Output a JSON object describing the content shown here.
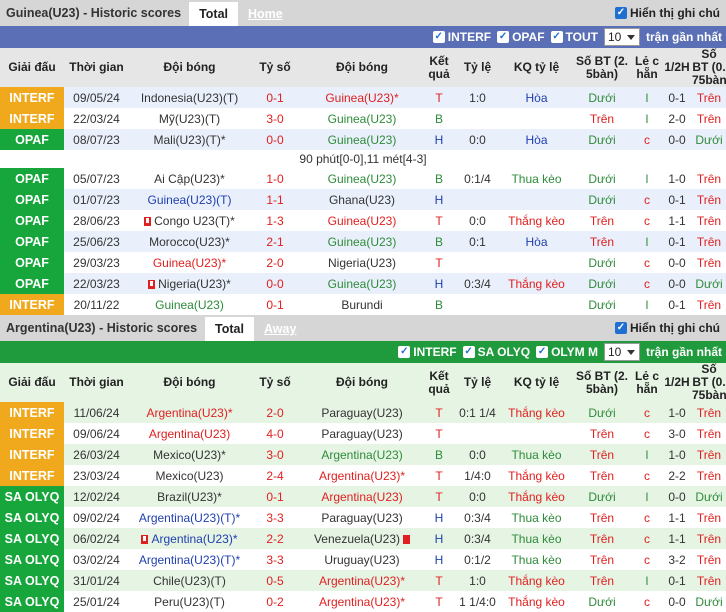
{
  "s1": {
    "title": "Guinea(U23) - Historic scores",
    "tab_total": "Total",
    "tab_other": "Home",
    "toggle": "Hiển thị ghi chú",
    "filters": [
      "INTERF",
      "OPAF",
      "TOUT"
    ],
    "count": "10",
    "count_label": "trận gần nhất",
    "cols": [
      "Giải đấu",
      "Thời gian",
      "Đội bóng",
      "Tỷ số",
      "Đội bóng",
      "Kết quả",
      "Tỷ lệ",
      "KQ tỷ lệ",
      "Số BT (2. 5bàn)",
      "Lẻ c hẵn",
      "1/2H",
      "Số BT (0. 75bàn)"
    ],
    "note": "90 phút[0-0],11 mét[4-3]",
    "rows": [
      {
        "lg": "INTERF",
        "t": "09/05/24",
        "h": "Indonesia(U23)(T)",
        "hc": "d",
        "s": "0-1",
        "a": "Guinea(U23)*",
        "ac": "r",
        "res": "T",
        "o": "1:0",
        "kq": "Hòa",
        "kqc": "b",
        "bt": "Dưới",
        "lc": "l",
        "ht": "0-1",
        "bt2": "Trên"
      },
      {
        "lg": "INTERF",
        "t": "22/03/24",
        "h": "Mỹ(U23)(T)",
        "hc": "d",
        "s": "3-0",
        "a": "Guinea(U23)",
        "ac": "g",
        "res": "B",
        "o": "",
        "kq": "",
        "kqc": "d",
        "bt": "Trên",
        "lc": "l",
        "ht": "2-0",
        "bt2": "Trên"
      },
      {
        "lg": "OPAF",
        "t": "08/07/23",
        "h": "Mali(U23)(T)*",
        "hc": "d",
        "s": "0-0",
        "a": "Guinea(U23)",
        "ac": "g",
        "res": "H",
        "o": "0:0",
        "kq": "Hòa",
        "kqc": "b",
        "bt": "Dưới",
        "lc": "c",
        "ht": "0-0",
        "bt2": "Dưới",
        "note": true
      },
      {
        "lg": "OPAF",
        "t": "05/07/23",
        "h": "Ai Cập(U23)*",
        "hc": "d",
        "s": "1-0",
        "a": "Guinea(U23)",
        "ac": "g",
        "res": "B",
        "o": "0:1/4",
        "kq": "Thua kèo",
        "kqc": "g",
        "bt": "Dưới",
        "lc": "l",
        "ht": "1-0",
        "bt2": "Trên"
      },
      {
        "lg": "OPAF",
        "t": "01/07/23",
        "h": "Guinea(U23)(T)",
        "hc": "b",
        "s": "1-1",
        "a": "Ghana(U23)",
        "ac": "d",
        "res": "H",
        "o": "",
        "kq": "",
        "kqc": "d",
        "bt": "Dưới",
        "lc": "c",
        "ht": "0-1",
        "bt2": "Trên"
      },
      {
        "lg": "OPAF",
        "t": "28/06/23",
        "h": "Congo U23(T)*",
        "hc": "d",
        "s": "1-3",
        "a": "Guinea(U23)",
        "ac": "r",
        "res": "T",
        "o": "0:0",
        "kq": "Thắng kèo",
        "kqc": "r",
        "bt": "Trên",
        "lc": "c",
        "ht": "1-1",
        "bt2": "Trên",
        "hcard": true
      },
      {
        "lg": "OPAF",
        "t": "25/06/23",
        "h": "Morocco(U23)*",
        "hc": "d",
        "s": "2-1",
        "a": "Guinea(U23)",
        "ac": "g",
        "res": "B",
        "o": "0:1",
        "kq": "Hòa",
        "kqc": "b",
        "bt": "Trên",
        "lc": "l",
        "ht": "0-1",
        "bt2": "Trên"
      },
      {
        "lg": "OPAF",
        "t": "29/03/23",
        "h": "Guinea(U23)*",
        "hc": "r",
        "s": "2-0",
        "a": "Nigeria(U23)",
        "ac": "d",
        "res": "T",
        "o": "",
        "kq": "",
        "kqc": "d",
        "bt": "Dưới",
        "lc": "c",
        "ht": "0-0",
        "bt2": "Trên"
      },
      {
        "lg": "OPAF",
        "t": "22/03/23",
        "h": "Nigeria(U23)*",
        "hc": "d",
        "s": "0-0",
        "a": "Guinea(U23)",
        "ac": "g",
        "res": "H",
        "o": "0:3/4",
        "kq": "Thắng kèo",
        "kqc": "r",
        "bt": "Dưới",
        "lc": "c",
        "ht": "0-0",
        "bt2": "Dưới",
        "hcard": true
      },
      {
        "lg": "INTERF",
        "t": "20/11/22",
        "h": "Guinea(U23)",
        "hc": "g",
        "s": "0-1",
        "a": "Burundi",
        "ac": "d",
        "res": "B",
        "o": "",
        "kq": "",
        "kqc": "d",
        "bt": "Dưới",
        "lc": "l",
        "ht": "0-1",
        "bt2": "Trên"
      }
    ]
  },
  "s2": {
    "title": "Argentina(U23) - Historic scores",
    "tab_total": "Total",
    "tab_other": "Away",
    "toggle": "Hiển thị ghi chú",
    "filters": [
      "INTERF",
      "SA OLYQ",
      "OLYM M"
    ],
    "count": "10",
    "count_label": "trận gần nhất",
    "cols": [
      "Giải đấu",
      "Thời gian",
      "Đội bóng",
      "Tỷ số",
      "Đội bóng",
      "Kết quả",
      "Tỷ lệ",
      "KQ tỷ lệ",
      "Số BT (2. 5bàn)",
      "Lẻ c hẵn",
      "1/2H",
      "Số BT (0. 75bàn)"
    ],
    "rows": [
      {
        "lg": "INTERF",
        "t": "11/06/24",
        "h": "Argentina(U23)*",
        "hc": "r",
        "s": "2-0",
        "a": "Paraguay(U23)",
        "ac": "d",
        "res": "T",
        "o": "0:1 1/4",
        "kq": "Thắng kèo",
        "kqc": "r",
        "bt": "Dưới",
        "lc": "c",
        "ht": "1-0",
        "bt2": "Trên"
      },
      {
        "lg": "INTERF",
        "t": "09/06/24",
        "h": "Argentina(U23)",
        "hc": "r",
        "s": "4-0",
        "a": "Paraguay(U23)",
        "ac": "d",
        "res": "T",
        "o": "",
        "kq": "",
        "kqc": "d",
        "bt": "Trên",
        "lc": "c",
        "ht": "3-0",
        "bt2": "Trên"
      },
      {
        "lg": "INTERF",
        "t": "26/03/24",
        "h": "Mexico(U23)*",
        "hc": "d",
        "s": "3-0",
        "a": "Argentina(U23)",
        "ac": "g",
        "res": "B",
        "o": "0:0",
        "kq": "Thua kèo",
        "kqc": "g",
        "bt": "Trên",
        "lc": "l",
        "ht": "1-0",
        "bt2": "Trên"
      },
      {
        "lg": "INTERF",
        "t": "23/03/24",
        "h": "Mexico(U23)",
        "hc": "d",
        "s": "2-4",
        "a": "Argentina(U23)*",
        "ac": "r",
        "res": "T",
        "o": "1/4:0",
        "kq": "Thắng kèo",
        "kqc": "r",
        "bt": "Trên",
        "lc": "c",
        "ht": "2-2",
        "bt2": "Trên"
      },
      {
        "lg": "SA OLYQ",
        "t": "12/02/24",
        "h": "Brazil(U23)*",
        "hc": "d",
        "s": "0-1",
        "a": "Argentina(U23)",
        "ac": "r",
        "res": "T",
        "o": "0:0",
        "kq": "Thắng kèo",
        "kqc": "r",
        "bt": "Dưới",
        "lc": "l",
        "ht": "0-0",
        "bt2": "Dưới"
      },
      {
        "lg": "SA OLYQ",
        "t": "09/02/24",
        "h": "Argentina(U23)(T)*",
        "hc": "b",
        "s": "3-3",
        "a": "Paraguay(U23)",
        "ac": "d",
        "res": "H",
        "o": "0:3/4",
        "kq": "Thua kèo",
        "kqc": "g",
        "bt": "Trên",
        "lc": "c",
        "ht": "1-1",
        "bt2": "Trên"
      },
      {
        "lg": "SA OLYQ",
        "t": "06/02/24",
        "h": "Argentina(U23)*",
        "hc": "b",
        "s": "2-2",
        "a": "Venezuela(U23)",
        "ac": "d",
        "res": "H",
        "o": "0:3/4",
        "kq": "Thua kèo",
        "kqc": "g",
        "bt": "Trên",
        "lc": "c",
        "ht": "1-1",
        "bt2": "Trên",
        "hcard": true,
        "acard": true
      },
      {
        "lg": "SA OLYQ",
        "t": "03/02/24",
        "h": "Argentina(U23)(T)*",
        "hc": "b",
        "s": "3-3",
        "a": "Uruguay(U23)",
        "ac": "d",
        "res": "H",
        "o": "0:1/2",
        "kq": "Thua kèo",
        "kqc": "g",
        "bt": "Trên",
        "lc": "c",
        "ht": "3-2",
        "bt2": "Trên"
      },
      {
        "lg": "SA OLYQ",
        "t": "31/01/24",
        "h": "Chile(U23)(T)",
        "hc": "d",
        "s": "0-5",
        "a": "Argentina(U23)*",
        "ac": "r",
        "res": "T",
        "o": "1:0",
        "kq": "Thắng kèo",
        "kqc": "r",
        "bt": "Trên",
        "lc": "l",
        "ht": "0-1",
        "bt2": "Trên"
      },
      {
        "lg": "SA OLYQ",
        "t": "25/01/24",
        "h": "Peru(U23)(T)",
        "hc": "d",
        "s": "0-2",
        "a": "Argentina(U23)*",
        "ac": "r",
        "res": "T",
        "o": "1 1/4:0",
        "kq": "Thắng kèo",
        "kqc": "r",
        "bt": "Dưới",
        "lc": "c",
        "ht": "0-0",
        "bt2": "Dưới"
      }
    ]
  },
  "colors": {
    "interf": "#f0a91c",
    "opaf": "#16a63b",
    "saolyq": "#16a63b",
    "s1bar": "#5a6fb5",
    "s2bar": "#1f9a3c",
    "rowA": "#eaf0fb",
    "rowB": "#ffffff",
    "rowA2": "#e6f4e4",
    "rowB2": "#ffffff"
  }
}
